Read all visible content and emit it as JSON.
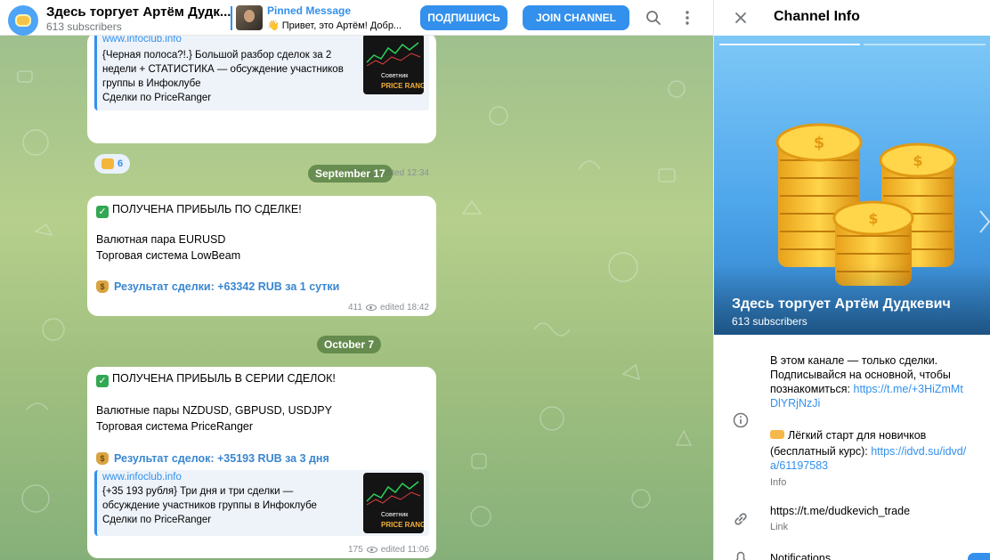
{
  "header": {
    "channel_title": "Здесь торгует Артём Дудк...",
    "subscribers": "613 subscribers",
    "pinned_title": "Pinned Message",
    "pinned_text": "👋 Привет, это Артём! Добр...",
    "subscribe_label": "ПОДПИШИСЬ",
    "join_label": "JOIN CHANNEL"
  },
  "messages": [
    {
      "site": "www.infoclub.info",
      "preview_lines": [
        "{Черная полоса?!.} Большой разбор сделок за 2",
        "недели + СТАТИСТИКА — обсуждение участников",
        "группы в Инфоклубе",
        "Сделки по PriceRanger"
      ],
      "thumb_small": "Советник",
      "thumb_big": "PRICE RANGER",
      "reaction_count": "6",
      "views": "573",
      "edited": "edited 12:34"
    },
    {
      "date": "September 17",
      "title": "ПОЛУЧЕНА ПРИБЫЛЬ ПО СДЕЛКЕ!",
      "line1": "Валютная пара EURUSD",
      "line2": "Торговая система LowBeam",
      "result": "Результат сделки: +63342 RUB за 1 сутки",
      "views": "411",
      "edited": "edited 18:42"
    },
    {
      "date": "October 7",
      "title": "ПОЛУЧЕНА ПРИБЫЛЬ В СЕРИИ СДЕЛОК!",
      "line1": "Валютные пары NZDUSD, GBPUSD, USDJPY",
      "line2": "Торговая система PriceRanger",
      "result": "Результат сделок: +35193 RUB за 3 дня",
      "site": "www.infoclub.info",
      "preview_lines": [
        "{+35 193 рубля} Три дня и три сделки —",
        "обсуждение участников группы в Инфоклубе",
        "Сделки по PriceRanger"
      ],
      "thumb_small": "Советник",
      "thumb_big": "PRICE RANGER",
      "views": "175",
      "edited": "edited 11:06"
    }
  ],
  "info_panel": {
    "heading": "Channel Info",
    "channel_name": "Здесь торгует Артём Дудкевич",
    "subscribers": "613 subscribers",
    "description_lines": [
      "В этом канале — только сделки.",
      "Подписывайся на основной, чтобы"
    ],
    "description_prefix": "познакомиться: ",
    "description_link_1": "https://t.me/+3HiZmMt",
    "description_link_2": "DlYRjNzJi",
    "course_line_1": "Лёгкий старт для новичков",
    "course_prefix": "(бесплатный курс): ",
    "course_link_1": "https://idvd.su/idvd/",
    "course_link_2": "a/61197583",
    "info_caption": "Info",
    "channel_link": "https://t.me/dudkevich_trade",
    "link_caption": "Link",
    "notifications_label": "Notifications"
  },
  "colors": {
    "accent": "#3390ec",
    "chat_bg": "#a6c58a",
    "result_text": "#3a86d0"
  }
}
